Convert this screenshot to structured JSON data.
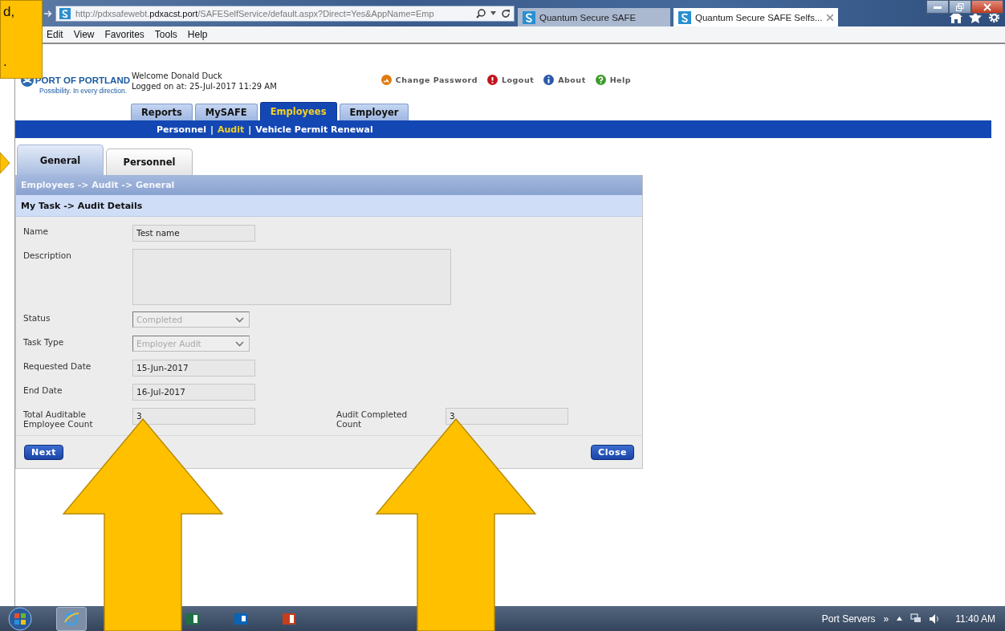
{
  "browser": {
    "address": {
      "host_prefix": "http://pdxsafewebt.",
      "host": "pdxacst.port",
      "path": "/SAFESelfService/default.aspx?Direct=Yes&AppName=Emp"
    },
    "tabs": [
      {
        "title": "Quantum Secure SAFE",
        "selected": false,
        "closable": false
      },
      {
        "title": "Quantum Secure SAFE Selfs...",
        "selected": true,
        "closable": true
      }
    ],
    "menu": [
      "Edit",
      "View",
      "Favorites",
      "Tools",
      "Help"
    ]
  },
  "page": {
    "logo": {
      "name": "PORT OF PORTLAND",
      "tagline": "Possibility. In every direction."
    },
    "welcome": "Welcome Donald Duck",
    "logged_on": "Logged on at: 25-Jul-2017 11:29 AM",
    "header_links": [
      {
        "label": "Change Password",
        "kind": "password"
      },
      {
        "label": "Logout",
        "kind": "logout"
      },
      {
        "label": "About",
        "kind": "about"
      },
      {
        "label": "Help",
        "kind": "help"
      }
    ],
    "nav_tabs": [
      {
        "label": "Reports",
        "selected": false
      },
      {
        "label": "MySAFE",
        "selected": false
      },
      {
        "label": "Employees",
        "selected": true
      },
      {
        "label": "Employer",
        "selected": false
      }
    ],
    "sub_nav_separator": "|",
    "sub_nav": [
      {
        "label": "Personnel",
        "selected": false
      },
      {
        "label": "Audit",
        "selected": true
      },
      {
        "label": "Vehicle Permit Renewal",
        "selected": false
      }
    ],
    "content_tabs": [
      {
        "label": "General",
        "selected": true
      },
      {
        "label": "Personnel",
        "selected": false
      }
    ],
    "breadcrumb": "Employees -> Audit -> General",
    "section_title": "My Task -> Audit Details",
    "form_rows": [
      {
        "fields": [
          {
            "label": "Name",
            "kind": "text",
            "value": "Test name"
          }
        ]
      },
      {
        "fields": [
          {
            "label": "Description",
            "kind": "textarea"
          }
        ]
      },
      {
        "fields": [
          {
            "label": "Status",
            "kind": "select",
            "value": "Completed",
            "disabled": true
          }
        ]
      },
      {
        "fields": [
          {
            "label": "Task Type",
            "kind": "select",
            "value": "Employer Audit",
            "disabled": true
          }
        ]
      },
      {
        "fields": [
          {
            "label": "Requested Date",
            "kind": "text",
            "value": "15-Jun-2017"
          }
        ]
      },
      {
        "fields": [
          {
            "label": "End Date",
            "kind": "text",
            "value": "16-Jul-2017"
          }
        ]
      },
      {
        "fields": [
          {
            "label": "Total Auditable Employee Count",
            "kind": "text",
            "value": "3"
          },
          {
            "label": "Audit Completed Count",
            "kind": "text",
            "value": "3"
          }
        ]
      }
    ],
    "buttons": [
      "Next",
      "Close"
    ]
  },
  "taskbar": {
    "tray_label": "Port Servers",
    "overflow": "»",
    "time": "11:40 AM"
  },
  "callout": {
    "lines": [
      "d,",
      "."
    ]
  }
}
